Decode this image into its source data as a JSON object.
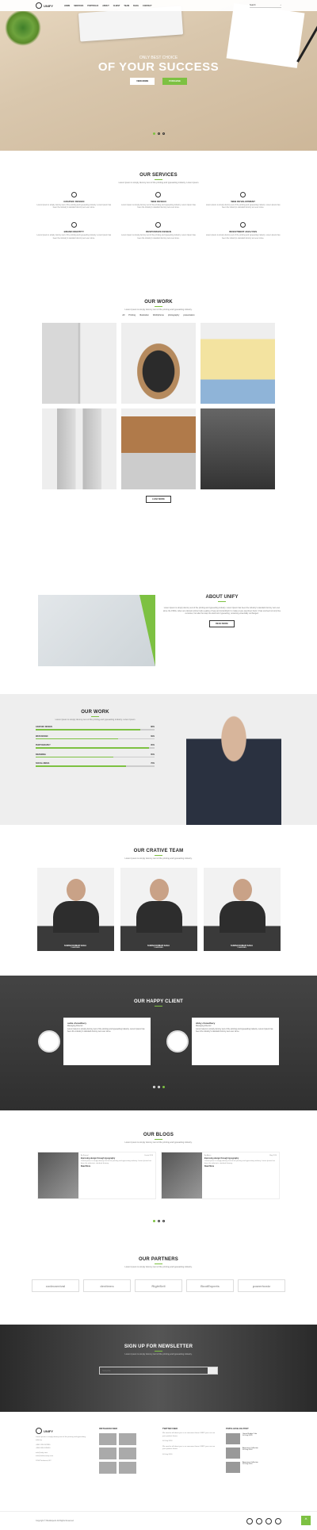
{
  "nav": {
    "logo_text": "UNIFY",
    "menu": [
      "HOME",
      "SERVICES",
      "PORTFOLIO",
      "ABOUT",
      "CLIENT",
      "TEAM",
      "BLOG",
      "CONTACT"
    ],
    "search_placeholder": "Search"
  },
  "hero": {
    "pre": "ONLY BEST CHOICE",
    "title": "OF YOUR SUCCESS",
    "btn1": "VIEW MORE",
    "btn2": "PURCHASE"
  },
  "services": {
    "title": "OUR SERVICES",
    "subtitle": "Lorem Ipsum is simply dummy text of the printing and typesetting industry. Lorem Ipsum",
    "items": [
      {
        "title": "GRAPHIC DESIGN"
      },
      {
        "title": "WEB DESIGN"
      },
      {
        "title": "WEB DEVELOPMENT"
      },
      {
        "title": "BRAND IDENTITY"
      },
      {
        "title": "RESPONSIVE DESIGN"
      },
      {
        "title": "INVESTMENT ANALYSIS"
      }
    ],
    "desc": "Lorem Ipsum is simply dummy text of the printing and typesetting industry. Lorem Ipsum has been the industry's standard dummy text ever since."
  },
  "work": {
    "title": "OUR WORK",
    "subtitle": "Lorem Ipsum is simply dummy text of the printing and typesetting industry.",
    "filters": [
      "All",
      "Printing",
      "Illustration",
      "Web/Iphone",
      "photography",
      "presentation"
    ],
    "load_more": "LOAD MORE"
  },
  "about": {
    "title": "ABOUT UNIFY",
    "text": "Lorem Ipsum is simply dummy text of the printing and typesetting industry. Lorem Ipsum has been the industry's standard dummy text ever since the 1500s, when an unknown printer took a galley of type and scrambled it to make a type specimen book. It has survived not only five centuries, but also the leap into electronic typesetting, remaining essentially unchanged.",
    "btn": "READ MORE"
  },
  "skills": {
    "title": "OUR WORK",
    "subtitle": "Lorem Ipsum is simply dummy text of the printing and typesetting industry. Lorem Ipsum",
    "items": [
      {
        "label": "GRAPHIC DESIGN",
        "pct": "88%",
        "v": 0.88
      },
      {
        "label": "WEB DESIGN",
        "pct": "69%",
        "v": 0.69
      },
      {
        "label": "PHOTOGRAPHY",
        "pct": "95%",
        "v": 0.95
      },
      {
        "label": "BRANDING",
        "pct": "65%",
        "v": 0.65
      },
      {
        "label": "SOCIAL MEDIA",
        "pct": "76%",
        "v": 0.76
      }
    ]
  },
  "team": {
    "title": "OUR CRATIVE TEAM",
    "subtitle": "Lorem Ipsum is simply dummy text of the printing and typesetting industry.",
    "members": [
      {
        "name": "SUMAN KUMAR SAHA",
        "role": "CHAIRMAN"
      },
      {
        "name": "SUMAN KUMAR SAHA",
        "role": "CHAIRMAN"
      },
      {
        "name": "SUMAN KUMAR SAHA",
        "role": "CHAIRMAN"
      }
    ]
  },
  "clients": {
    "title": "OUR HAPPY CLIENT",
    "items": [
      {
        "name": "sutta chowdhury",
        "role": "Managing Director",
        "text": "Lorem Ipsum is simply dummy text of the printing and typesetting industry. Lorem Ipsum has been the industry's standard dummy text ever since."
      },
      {
        "name": "Abby chowdhury",
        "role": "Managing Director",
        "text": "Lorem Ipsum is simply dummy text of the printing and typesetting industry. Lorem Ipsum has been the industry's standard dummy text ever since."
      }
    ]
  },
  "blogs": {
    "title": "OUR BLOGS",
    "subtitle": "Lorem Ipsum is simply dummy text of the printing and typesetting industry.",
    "items": [
      {
        "author": "By Nazmul",
        "date": "Create 2014",
        "title": "Improving design through typography",
        "text": "Lorem Ipsum is simply dummy text of the printing and typesetting industry. Lorem Ipsum has been the industry's standard dummy.",
        "more": "Read More"
      },
      {
        "author": "By Admin",
        "date": "May 2014",
        "title": "Improving design through typography",
        "text": "Lorem Ipsum is simply dummy text of the printing and typesetting industry. Lorem Ipsum has been the industry's standard dummy.",
        "more": "Read More"
      }
    ]
  },
  "partners": {
    "title": "OUR PARTNERS",
    "subtitle": "Lorem Ipsum is simply dummy text of the printing and typesetting industry.",
    "logos": [
      "codecarnival",
      "devitems",
      "RightSell",
      "BootExperts",
      "powerhostz"
    ]
  },
  "newsletter": {
    "title": "SIGN UP FOR NEWSLETTER",
    "subtitle": "Lorem Ipsum is simply dummy text of the printing and typesetting industry.",
    "placeholder": "Subscribe"
  },
  "footer": {
    "about": "Lorem Ipsum is simply dummy text of the printing and typesetting industry.",
    "phone": "+880 1234 567890",
    "phone2": "+880 0456 345650",
    "email": "info@unify.com",
    "email2": "info@anthercomp.com",
    "address": "1234 Parkstreet, NY",
    "insta_title": "INSTAGRAM FEED",
    "twitter_title": "TWITTER FEED",
    "tweet": "We need to tell about you is an awesome theme UNIFY you can see your product theme.",
    "tweet_date": "04 July 2016",
    "popular_title": "POPULAR BLOG POST",
    "posts": [
      {
        "t": "Green Bridge Cafe",
        "d": "04 July 2016"
      },
      {
        "t": "Awesome Collection",
        "d": "04 July 2016"
      },
      {
        "t": "Awesome Collection",
        "d": "04 July 2016"
      }
    ]
  },
  "bottom": {
    "copyright": "Copyright © BootExperts All Rights Reserved"
  }
}
